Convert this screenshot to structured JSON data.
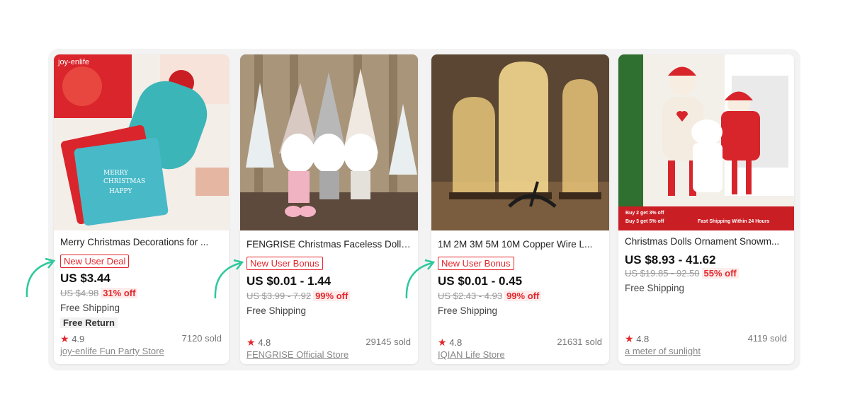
{
  "products": [
    {
      "title": "Merry Christmas Decorations for ...",
      "badge": "New User Deal",
      "price": "US $3.44",
      "old_price": "US $4.98",
      "discount": "31% off",
      "shipping": "Free Shipping",
      "extra": "Free Return",
      "rating": "4.9",
      "sold": "7120 sold",
      "store": "joy-enlife Fun Party Store",
      "image_text": "joy-enlife"
    },
    {
      "title": "FENGRISE Christmas Faceless Doll ...",
      "badge": "New User Bonus",
      "price": "US $0.01 - 1.44",
      "old_price": "US $3.99 - 7.92",
      "discount": "99% off",
      "shipping": "Free Shipping",
      "rating": "4.8",
      "sold": "29145 sold",
      "store": "FENGRISE Official Store"
    },
    {
      "title": "1M 2M 3M 5M 10M Copper Wire L...",
      "badge": "New User Bonus",
      "price": "US $0.01 - 0.45",
      "old_price": "US $2.43 - 4.93",
      "discount": "99% off",
      "shipping": "Free Shipping",
      "rating": "4.8",
      "sold": "21631 sold",
      "store": "IQIAN Life Store"
    },
    {
      "title": "Christmas Dolls Ornament Snowm...",
      "price": "US $8.93 - 41.62",
      "old_price": "US $19.85 - 92.50",
      "discount": "55% off",
      "shipping": "Free Shipping",
      "rating": "4.8",
      "sold": "4119 sold",
      "store": "a meter of sunlight",
      "banner_line1": "Buy 2 get 3% off",
      "banner_line2": "Buy 3 get 5% off",
      "banner_right": "Fast Shipping Within 24 Hours"
    }
  ],
  "colors": {
    "accent_red": "#e4262b",
    "arrow_green": "#2fc89b"
  },
  "icons": {
    "star": "★",
    "arrow": "curved-arrow-icon"
  }
}
